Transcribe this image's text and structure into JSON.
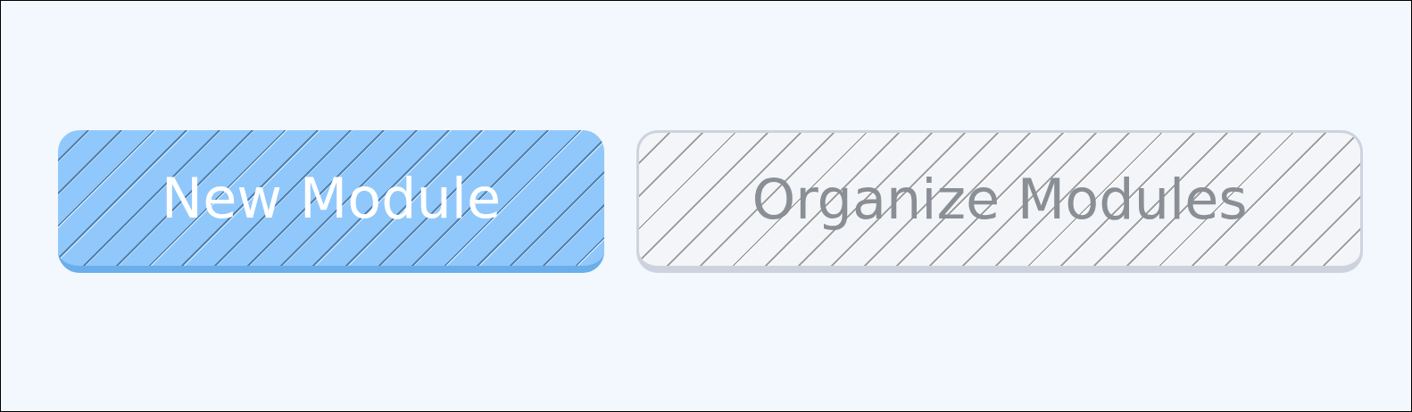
{
  "buttons": [
    {
      "label": "New Module",
      "kind": "primary"
    },
    {
      "label": "Organize Modules",
      "kind": "secondary"
    }
  ]
}
